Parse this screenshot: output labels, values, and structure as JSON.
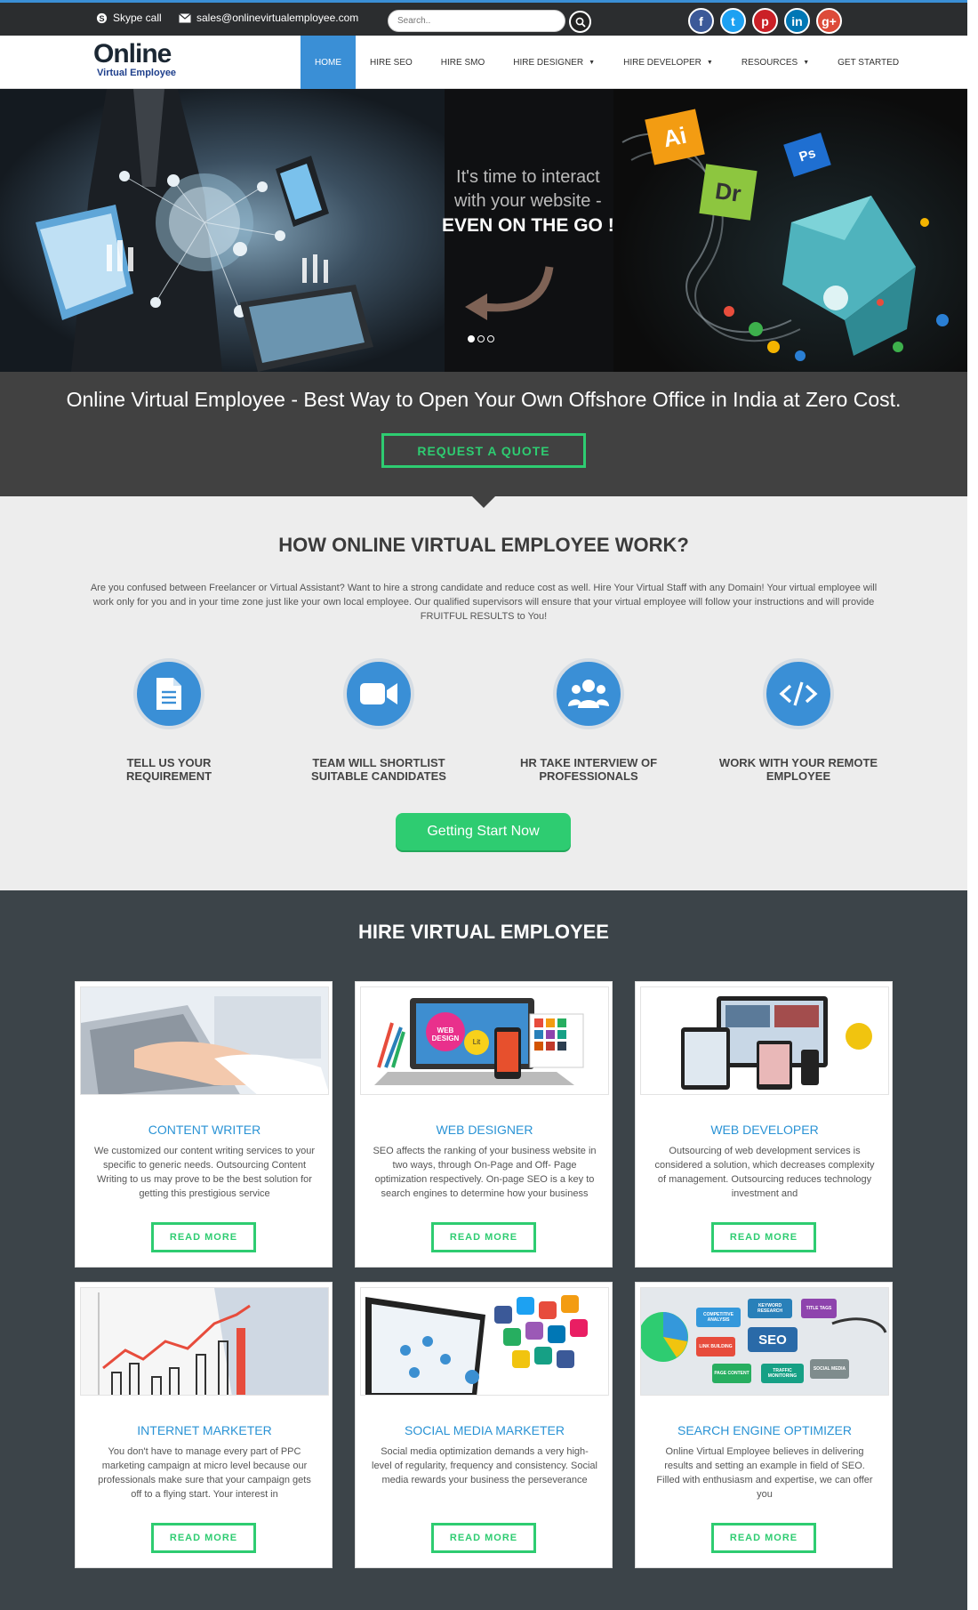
{
  "topbar": {
    "skype_label": "Skype call",
    "email": "sales@onlinevirtualemployee.com",
    "search_placeholder": "Search.."
  },
  "social": [
    {
      "name": "facebook",
      "glyph": "f",
      "color": "#3b5998"
    },
    {
      "name": "twitter",
      "glyph": "t",
      "color": "#1da1f2"
    },
    {
      "name": "pinterest",
      "glyph": "p",
      "color": "#cb2027"
    },
    {
      "name": "linkedin",
      "glyph": "in",
      "color": "#0077b5"
    },
    {
      "name": "googleplus",
      "glyph": "g+",
      "color": "#dd4b39"
    }
  ],
  "logo": {
    "main": "Online",
    "sub": "Virtual Employee"
  },
  "nav": {
    "items": [
      {
        "label": "HOME",
        "active": true,
        "dropdown": false
      },
      {
        "label": "HIRE SEO",
        "active": false,
        "dropdown": false
      },
      {
        "label": "HIRE SMO",
        "active": false,
        "dropdown": false
      },
      {
        "label": "HIRE DESIGNER",
        "active": false,
        "dropdown": true
      },
      {
        "label": "HIRE DEVELOPER",
        "active": false,
        "dropdown": true
      },
      {
        "label": "RESOURCES",
        "active": false,
        "dropdown": true
      },
      {
        "label": "GET STARTED",
        "active": false,
        "dropdown": false
      }
    ]
  },
  "hero": {
    "line1": "It's time to interact",
    "line2": "with your website -",
    "line3": "EVEN ON THE GO !",
    "badges": [
      "Ai",
      "Dr",
      "Ps"
    ]
  },
  "banner": {
    "title": "Online Virtual Employee - Best Way to Open Your Own Offshore Office in India at Zero Cost.",
    "button": "REQUEST A QUOTE"
  },
  "how": {
    "title": "HOW ONLINE VIRTUAL EMPLOYEE WORK?",
    "description": "Are you confused between Freelancer or Virtual Assistant? Want to hire a strong candidate and reduce cost as well. Hire Your Virtual Staff with any Domain! Your virtual employee will work only for you and in your time zone just like your own local employee. Our qualified supervisors will ensure that your virtual employee will follow your instructions and will provide FRUITFUL RESULTS to You!",
    "steps": [
      {
        "label": "TELL US YOUR REQUIREMENT",
        "icon": "document-icon"
      },
      {
        "label": "TEAM WILL SHORTLIST SUITABLE CANDIDATES",
        "icon": "video-camera-icon"
      },
      {
        "label": "HR TAKE INTERVIEW OF PROFESSIONALS",
        "icon": "users-icon"
      },
      {
        "label": "WORK WITH YOUR REMOTE EMPLOYEE",
        "icon": "code-icon"
      }
    ],
    "button": "Getting Start Now"
  },
  "hire": {
    "title": "HIRE VIRTUAL EMPLOYEE",
    "read_more": "READ MORE",
    "cards": [
      {
        "title": "CONTENT WRITER",
        "text": "We customized our content writing services to your specific to generic needs. Outsourcing Content Writing to us may prove to be the best solution for getting this prestigious service"
      },
      {
        "title": "WEB DESIGNER",
        "text": "SEO affects the ranking of your business website in two ways, through On-Page and Off- Page optimization respectively. On-page SEO is a key to search engines to determine how your business"
      },
      {
        "title": "WEB DEVELOPER",
        "text": "Outsourcing of web development services is considered a solution, which decreases complexity of management. Outsourcing reduces technology investment and"
      },
      {
        "title": "INTERNET MARKETER",
        "text": "You don't have to manage every part of PPC marketing campaign at micro level because our professionals make sure that your campaign gets off to a flying start. Your interest in"
      },
      {
        "title": "SOCIAL MEDIA MARKETER",
        "text": "Social media optimization demands a very high-level of regularity, frequency and consistency. Social media rewards your business the perseverance"
      },
      {
        "title": "SEARCH ENGINE OPTIMIZER",
        "text": "Online Virtual Employee believes in delivering results and setting an example in field of SEO. Filled with enthusiasm and expertise, we can offer you"
      }
    ],
    "image_labels": {
      "designer": [
        "WEB DESIGN",
        "Lit"
      ],
      "seo": [
        "SEO",
        "LINK BUILDING",
        "PAGE CONTENT",
        "KEYWORD RESEARCH",
        "TITLE TAGS",
        "SOCIAL MEDIA",
        "TRAFFIC MONITORING",
        "COMPETITIVE ANALYSIS"
      ]
    }
  }
}
